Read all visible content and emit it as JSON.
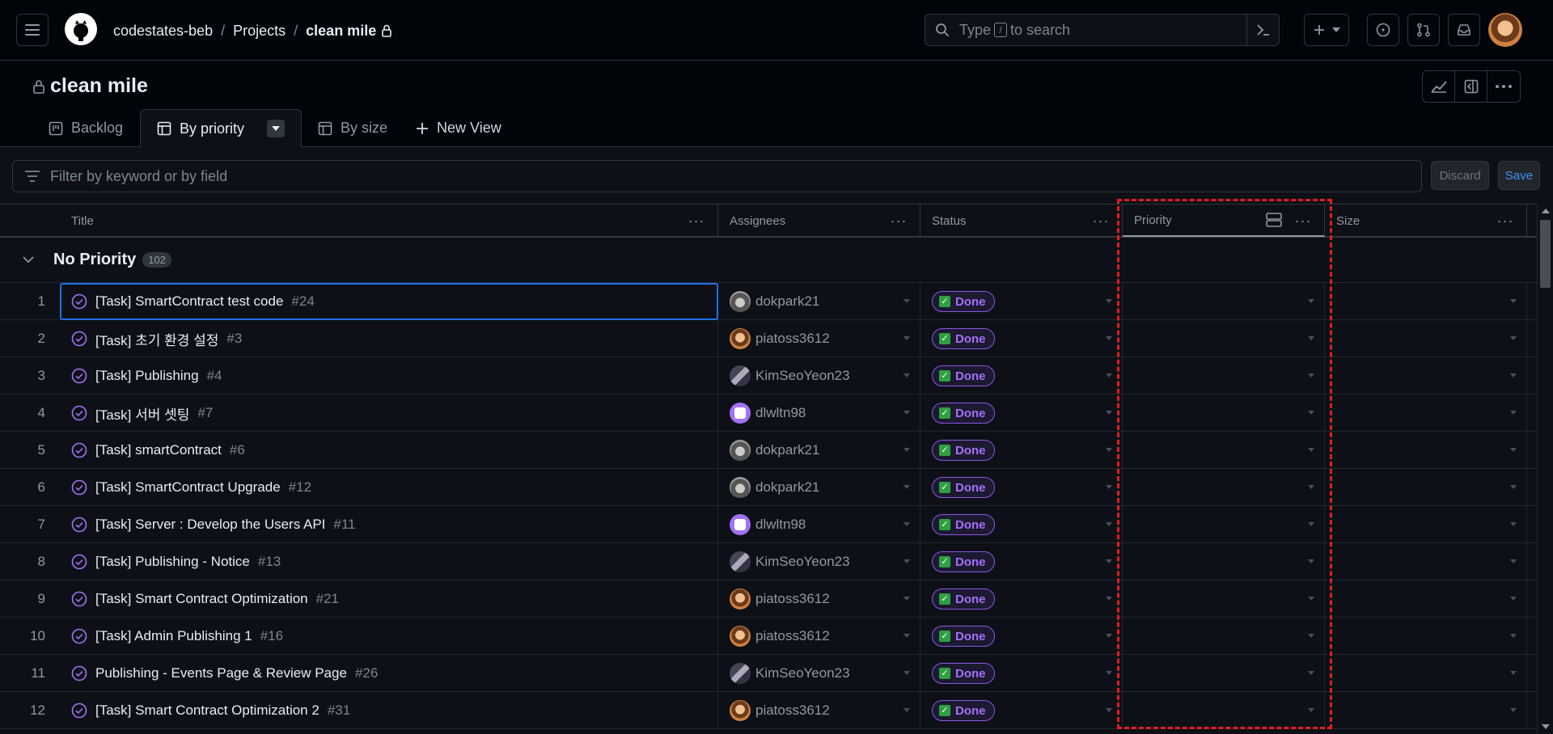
{
  "header": {
    "breadcrumb": [
      "codestates-beb",
      "Projects",
      "clean mile"
    ],
    "search_placeholder_before": "Type",
    "search_kbd": "/",
    "search_placeholder_after": "to search"
  },
  "project": {
    "title": "clean mile",
    "tabs": [
      {
        "label": "Backlog",
        "active": false
      },
      {
        "label": "By priority",
        "active": true
      },
      {
        "label": "By size",
        "active": false
      }
    ],
    "new_view_label": "New View"
  },
  "filter": {
    "placeholder": "Filter by keyword or by field",
    "discard_label": "Discard",
    "save_label": "Save"
  },
  "table": {
    "columns": [
      "Title",
      "Assignees",
      "Status",
      "Priority",
      "Size"
    ],
    "group": {
      "name": "No Priority",
      "count": "102"
    },
    "rows": [
      {
        "n": "1",
        "title": "[Task] SmartContract test code",
        "num": "#24",
        "assignee": "dokpark21",
        "av": "dok",
        "status": "Done"
      },
      {
        "n": "2",
        "title": "[Task] 초기 환경 설정",
        "num": "#3",
        "assignee": "piatoss3612",
        "av": "pia",
        "status": "Done"
      },
      {
        "n": "3",
        "title": "[Task] Publishing",
        "num": "#4",
        "assignee": "KimSeoYeon23",
        "av": "kim",
        "status": "Done"
      },
      {
        "n": "4",
        "title": "[Task] 서버 셋팅",
        "num": "#7",
        "assignee": "dlwltn98",
        "av": "dlw",
        "status": "Done"
      },
      {
        "n": "5",
        "title": "[Task] smartContract",
        "num": "#6",
        "assignee": "dokpark21",
        "av": "dok",
        "status": "Done"
      },
      {
        "n": "6",
        "title": "[Task] SmartContract Upgrade",
        "num": "#12",
        "assignee": "dokpark21",
        "av": "dok",
        "status": "Done"
      },
      {
        "n": "7",
        "title": "[Task] Server : Develop the Users API",
        "num": "#11",
        "assignee": "dlwltn98",
        "av": "dlw",
        "status": "Done"
      },
      {
        "n": "8",
        "title": "[Task] Publishing - Notice",
        "num": "#13",
        "assignee": "KimSeoYeon23",
        "av": "kim",
        "status": "Done"
      },
      {
        "n": "9",
        "title": "[Task] Smart Contract Optimization",
        "num": "#21",
        "assignee": "piatoss3612",
        "av": "pia",
        "status": "Done"
      },
      {
        "n": "10",
        "title": "[Task] Admin Publishing 1",
        "num": "#16",
        "assignee": "piatoss3612",
        "av": "pia",
        "status": "Done"
      },
      {
        "n": "11",
        "title": "Publishing - Events Page & Review Page",
        "num": "#26",
        "assignee": "KimSeoYeon23",
        "av": "kim",
        "status": "Done"
      },
      {
        "n": "12",
        "title": "[Task] Smart Contract Optimization 2",
        "num": "#31",
        "assignee": "piatoss3612",
        "av": "pia",
        "status": "Done"
      }
    ]
  },
  "colors": {
    "background": "#010409",
    "status_done": "#a371f7",
    "focus": "#1f6feb",
    "highlight": "#e11d21"
  },
  "icons": [
    "menu-icon",
    "github-logo-icon",
    "lock-icon",
    "search-icon",
    "terminal-icon",
    "plus-icon",
    "issue-icon",
    "pull-request-icon",
    "inbox-icon",
    "chart-icon",
    "sidebar-icon",
    "kebab-icon",
    "board-icon",
    "table-icon",
    "filter-icon",
    "chevron-down-icon",
    "issue-closed-icon",
    "group-icon"
  ]
}
